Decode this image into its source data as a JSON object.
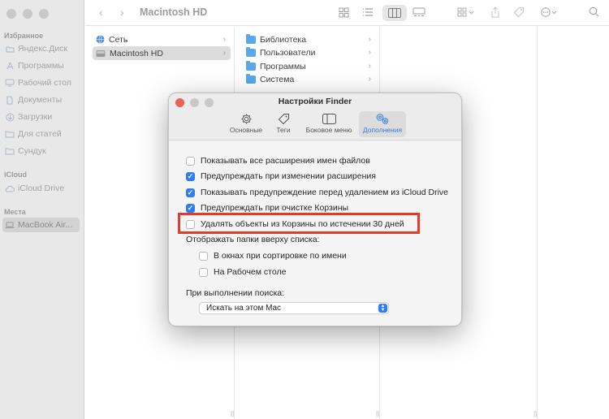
{
  "window": {
    "title": "Macintosh HD"
  },
  "sidebar": {
    "favorites_label": "Избранное",
    "favorites": [
      {
        "label": "Яндекс.Диск",
        "icon": "yandex-disk-icon"
      },
      {
        "label": "Программы",
        "icon": "applications-icon"
      },
      {
        "label": "Рабочий стол",
        "icon": "desktop-icon"
      },
      {
        "label": "Документы",
        "icon": "document-icon"
      },
      {
        "label": "Загрузки",
        "icon": "downloads-icon"
      },
      {
        "label": "Для статей",
        "icon": "folder-icon"
      },
      {
        "label": "Сундук",
        "icon": "folder-icon"
      }
    ],
    "icloud_label": "iCloud",
    "icloud": [
      {
        "label": "iCloud Drive",
        "icon": "cloud-icon"
      }
    ],
    "places_label": "Места",
    "places": [
      {
        "label": "MacBook Air...",
        "icon": "laptop-icon",
        "selected": true
      }
    ]
  },
  "columns": {
    "col1": [
      {
        "label": "Сеть",
        "icon": "network-globe-icon"
      },
      {
        "label": "Macintosh HD",
        "icon": "hard-drive-icon",
        "selected": true
      }
    ],
    "col2": [
      {
        "label": "Библиотека"
      },
      {
        "label": "Пользователи"
      },
      {
        "label": "Программы"
      },
      {
        "label": "Система"
      }
    ]
  },
  "dialog": {
    "title": "Настройки Finder",
    "tabs": [
      {
        "label": "Основные",
        "icon": "gear-icon"
      },
      {
        "label": "Теги",
        "icon": "tag-icon"
      },
      {
        "label": "Боковое меню",
        "icon": "sidebar-icon"
      },
      {
        "label": "Дополнения",
        "icon": "gears-icon",
        "active": true
      }
    ],
    "options": [
      {
        "label": "Показывать все расширения имен файлов",
        "checked": false
      },
      {
        "label": "Предупреждать при изменении расширения",
        "checked": true
      },
      {
        "label": "Показывать предупреждение перед удалением из iCloud Drive",
        "checked": true
      },
      {
        "label": "Предупреждать при очистке Корзины",
        "checked": true
      },
      {
        "label": "Удалять объекты из Корзины по истечении 30 дней",
        "checked": false
      }
    ],
    "folders_on_top_label": "Отображать папки вверху списка:",
    "folders_on_top": [
      {
        "label": "В окнах при сортировке по имени",
        "checked": false
      },
      {
        "label": "На Рабочем столе",
        "checked": false
      }
    ],
    "search_label": "При выполнении поиска:",
    "search_scope": "Искать на этом Mac"
  },
  "colors": {
    "accent": "#2e7cf6",
    "highlight": "#e23a2c",
    "close": "#ee5f57",
    "minimize": "#c9c8c8",
    "zoom": "#c9c8c8"
  }
}
